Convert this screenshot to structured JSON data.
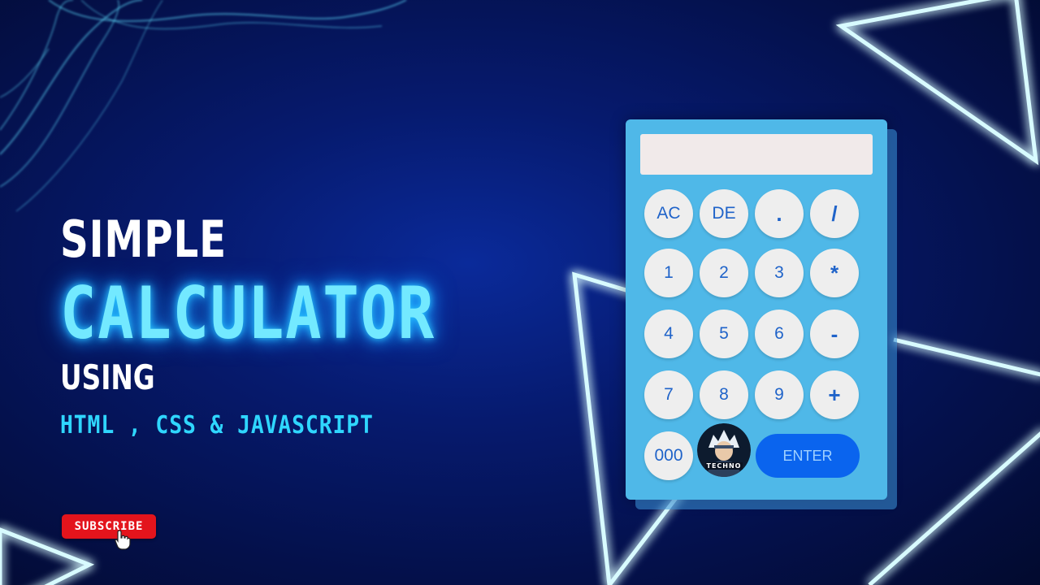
{
  "headline": {
    "line1": "SIMPLE",
    "line2": "CALCULATOR",
    "line3": "USING",
    "line4": "HTML , CSS & JAVASCRIPT"
  },
  "subscribe_label": "SUBSCRIBE",
  "calculator": {
    "display_value": "",
    "keys": {
      "ac": "AC",
      "de": "DE",
      "dot": ".",
      "divide": "/",
      "k1": "1",
      "k2": "2",
      "k3": "3",
      "multiply": "*",
      "k4": "4",
      "k5": "5",
      "k6": "6",
      "minus": "-",
      "k7": "7",
      "k8": "8",
      "k9": "9",
      "plus": "+",
      "k000": "000",
      "enter": "ENTER"
    },
    "logo_text": "TECHNO"
  },
  "colors": {
    "neon": "#3ff0ff",
    "calc_body": "#4fb8e8",
    "key_text": "#1f63c9",
    "enter": "#0a64ee",
    "subscribe": "#e3141c"
  },
  "icons": {
    "cursor": "hand-pointer-icon",
    "logo": "avatar-logo-icon"
  }
}
